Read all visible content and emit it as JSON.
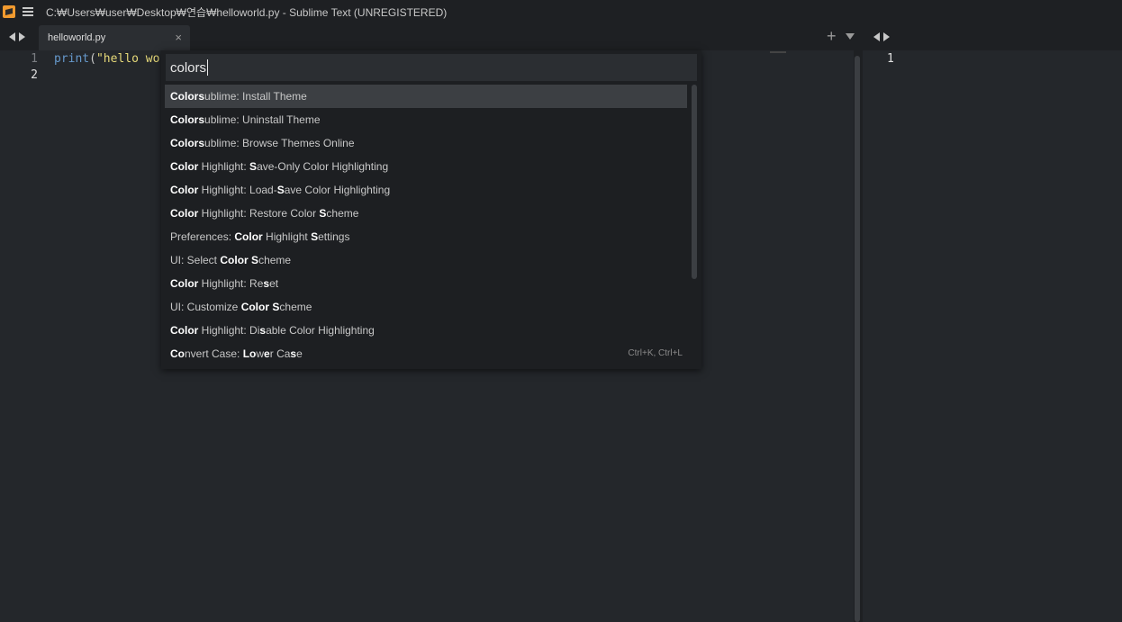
{
  "window": {
    "title": "C:₩Users₩user₩Desktop₩연습₩helloworld.py - Sublime Text (UNREGISTERED)"
  },
  "tabs": {
    "active_tab_label": "helloworld.py",
    "close_glyph": "×",
    "plus_glyph": "+"
  },
  "editor_left": {
    "lines": [
      "1",
      "2"
    ],
    "code": {
      "fn": "print",
      "open": "(",
      "str": "\"hello wo"
    }
  },
  "editor_right": {
    "lines": [
      "1"
    ]
  },
  "command_palette": {
    "query": "colors",
    "results": [
      {
        "parts": [
          [
            "b",
            "Colors"
          ],
          [
            "t",
            "ublime: Install Theme"
          ]
        ],
        "selected": true
      },
      {
        "parts": [
          [
            "b",
            "Colors"
          ],
          [
            "t",
            "ublime: Uninstall Theme"
          ]
        ]
      },
      {
        "parts": [
          [
            "b",
            "Colors"
          ],
          [
            "t",
            "ublime: Browse Themes Online"
          ]
        ]
      },
      {
        "parts": [
          [
            "b",
            "Color"
          ],
          [
            "t",
            " Highlight: "
          ],
          [
            "b",
            "S"
          ],
          [
            "t",
            "ave-Only Color Highlighting"
          ]
        ]
      },
      {
        "parts": [
          [
            "b",
            "Color"
          ],
          [
            "t",
            " Highlight: Load-"
          ],
          [
            "b",
            "S"
          ],
          [
            "t",
            "ave Color Highlighting"
          ]
        ]
      },
      {
        "parts": [
          [
            "b",
            "Color"
          ],
          [
            "t",
            " Highlight: Restore Color "
          ],
          [
            "b",
            "S"
          ],
          [
            "t",
            "cheme"
          ]
        ]
      },
      {
        "parts": [
          [
            "t",
            "Preferences: "
          ],
          [
            "b",
            "Color"
          ],
          [
            "t",
            " Highlight "
          ],
          [
            "b",
            "S"
          ],
          [
            "t",
            "ettings"
          ]
        ]
      },
      {
        "parts": [
          [
            "t",
            "UI: Select "
          ],
          [
            "b",
            "Color"
          ],
          [
            "t",
            " "
          ],
          [
            "b",
            "S"
          ],
          [
            "t",
            "cheme"
          ]
        ]
      },
      {
        "parts": [
          [
            "b",
            "Color"
          ],
          [
            "t",
            " Highlight: Re"
          ],
          [
            "b",
            "s"
          ],
          [
            "t",
            "et"
          ]
        ]
      },
      {
        "parts": [
          [
            "t",
            "UI: Customize "
          ],
          [
            "b",
            "Color"
          ],
          [
            "t",
            " "
          ],
          [
            "b",
            "S"
          ],
          [
            "t",
            "cheme"
          ]
        ]
      },
      {
        "parts": [
          [
            "b",
            "Color"
          ],
          [
            "t",
            " Highlight: Di"
          ],
          [
            "b",
            "s"
          ],
          [
            "t",
            "able Color Highlighting"
          ]
        ]
      },
      {
        "parts": [
          [
            "b",
            "Co"
          ],
          [
            "t",
            "nvert Case: "
          ],
          [
            "b",
            "Lo"
          ],
          [
            "t",
            "w"
          ],
          [
            "b",
            "e"
          ],
          [
            "t",
            "r Ca"
          ],
          [
            "b",
            "s"
          ],
          [
            "t",
            "e"
          ]
        ],
        "shortcut": "Ctrl+K, Ctrl+L"
      }
    ]
  },
  "colors": {
    "background": "#24272b",
    "titlebar": "#1e2023",
    "palette_bg": "#1d1f22",
    "selected_row": "#3c3f43",
    "string": "#e6d979",
    "function": "#6699cc"
  }
}
